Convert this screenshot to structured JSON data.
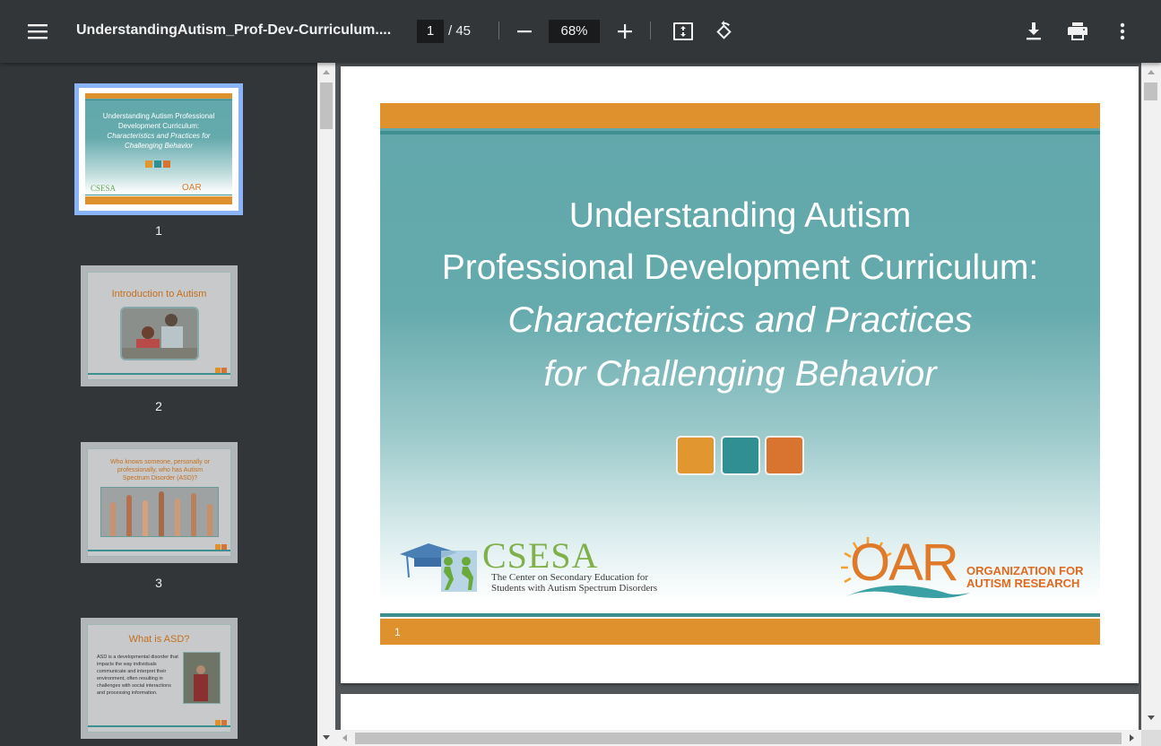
{
  "toolbar": {
    "title": "UnderstandingAutism_Prof-Dev-Curriculum....",
    "current_page": "1",
    "total_pages": "/ 45",
    "zoom": "68%"
  },
  "icons": {
    "menu": "hamburger-menu-icon",
    "zoom_out": "minus-icon",
    "zoom_in": "plus-icon",
    "fit": "fit-to-page-icon",
    "rotate": "rotate-icon",
    "download": "download-icon",
    "print": "print-icon",
    "more": "more-vert-icon"
  },
  "thumbnails": [
    {
      "number": "1",
      "title": "Understanding Autism Professional Development Curriculum:",
      "subtitle": "Characteristics and Practices for Challenging Behavior",
      "active": true
    },
    {
      "number": "2",
      "title": "Introduction to Autism"
    },
    {
      "number": "3",
      "title": "Who knows someone, personally or professionally, who has Autism Spectrum Disorder (ASD)?"
    },
    {
      "number": "4",
      "title": "What is ASD?",
      "body": "ASD is a developmental disorder that impacts the way individuals communicate and interpret their environment, often resulting in challenges with social interactions and processing information."
    }
  ],
  "slide": {
    "title_line1": "Understanding Autism",
    "title_line2": "Professional Development Curriculum:",
    "subtitle_line1": "Characteristics and Practices",
    "subtitle_line2": "for Challenging Behavior",
    "page_number": "1",
    "csesa_logo": "CSESA",
    "csesa_line1": "The Center on Secondary Education for",
    "csesa_line2": "Students with Autism Spectrum Disorders",
    "oar_logo": "OAR",
    "oar_line1": "ORGANIZATION FOR",
    "oar_line2": "AUTISM RESEARCH"
  },
  "colors": {
    "orange": "#df912e",
    "teal": "#3e8f8f",
    "square1": "#e1962f",
    "square2": "#2f8f91",
    "square3": "#d8742f"
  }
}
